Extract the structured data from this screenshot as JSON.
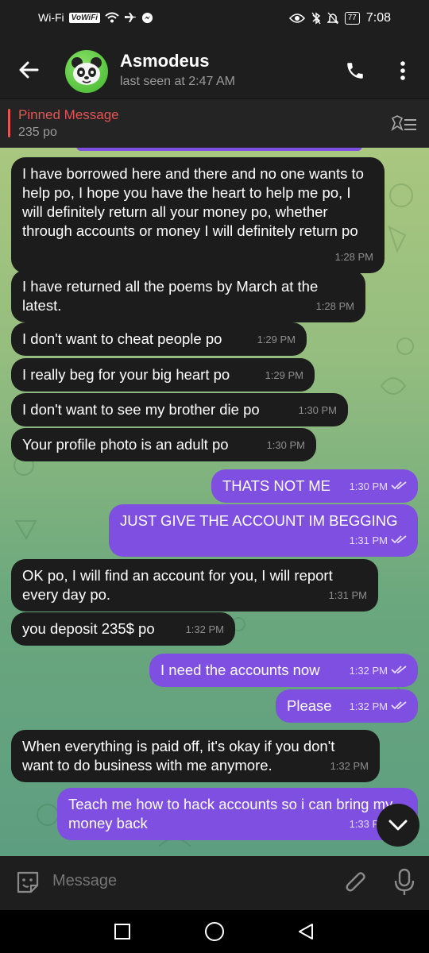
{
  "status_bar": {
    "carrier": "Wi-Fi",
    "volte": "VoWiFi",
    "battery": "77",
    "time": "7:08"
  },
  "header": {
    "title": "Asmodeus",
    "subtitle": "last seen at 2:47 AM"
  },
  "pinned": {
    "title": "Pinned Message",
    "text": "235 po"
  },
  "messages": [
    {
      "dir": "in",
      "text": "I have borrowed here and there and no one wants to help po, I hope you have the heart to help me po, I will definitely return all your money po, whether through accounts or money I will definitely return po",
      "time": "1:28 PM"
    },
    {
      "dir": "in",
      "text": "I have returned all the poems by March at the latest.",
      "time": "1:28 PM"
    },
    {
      "dir": "in",
      "text": "I don't want to cheat people po",
      "time": "1:29 PM"
    },
    {
      "dir": "in",
      "text": "I really beg for your big heart po",
      "time": "1:29 PM"
    },
    {
      "dir": "in",
      "text": "I don't want to see my brother die po",
      "time": "1:30 PM"
    },
    {
      "dir": "in",
      "text": "Your profile photo is an adult po",
      "time": "1:30 PM"
    },
    {
      "dir": "out",
      "text": "THATS NOT ME",
      "time": "1:30 PM"
    },
    {
      "dir": "out",
      "text": "JUST GIVE THE ACCOUNT IM BEGGING",
      "time": "1:31 PM"
    },
    {
      "dir": "in",
      "text": "OK po, I will find an account for you, I will report every day po.",
      "time": "1:31 PM"
    },
    {
      "dir": "in",
      "text": "you deposit 235$ po",
      "time": "1:32 PM"
    },
    {
      "dir": "out",
      "text": "I need the accounts now",
      "time": "1:32 PM"
    },
    {
      "dir": "out",
      "text": "Please",
      "time": "1:32 PM"
    },
    {
      "dir": "in",
      "text": "When everything is paid off, it's okay if you don't want to do business with me anymore.",
      "time": "1:32 PM"
    },
    {
      "dir": "out",
      "text": "Teach me how to hack accounts so i can bring my money back",
      "time": "1:33 PM"
    }
  ],
  "input": {
    "placeholder": "Message"
  },
  "icons": [
    "back-arrow-icon",
    "panda-avatar",
    "phone-icon",
    "more-vert-icon",
    "unpin-list-icon",
    "emoji-sticker-icon",
    "attach-icon",
    "mic-icon",
    "chevron-down-icon",
    "nav-square-icon",
    "nav-circle-icon",
    "nav-back-icon"
  ],
  "colors": {
    "outgoing_bubble": "#7e4fe0",
    "incoming_bubble": "#1c1c1c",
    "pinned_accent": "#e25654",
    "header": "#1e1e1e"
  }
}
